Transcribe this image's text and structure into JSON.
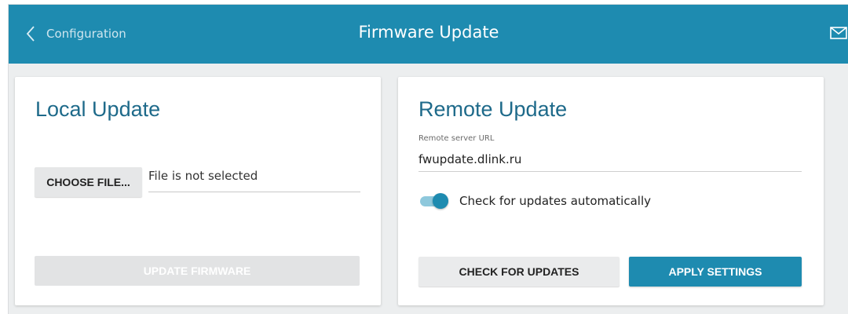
{
  "header": {
    "back_label": "Configuration",
    "title": "Firmware Update",
    "icons": {
      "back": "chevron-left-icon",
      "mail": "mail-icon"
    },
    "background_color": "#1e8bb0"
  },
  "local_update": {
    "title": "Local Update",
    "choose_file_label": "CHOOSE FILE...",
    "file_status": "File is not selected",
    "update_firmware_label": "UPDATE FIRMWARE",
    "update_firmware_disabled": true
  },
  "remote_update": {
    "title": "Remote Update",
    "url_label": "Remote server URL",
    "url_value": "fwupdate.dlink.ru",
    "auto_check_label": "Check for updates automatically",
    "auto_check_enabled": true,
    "check_button_label": "CHECK FOR UPDATES",
    "apply_button_label": "APPLY SETTINGS"
  },
  "colors": {
    "accent": "#1e8bb0",
    "title_text": "#1e6a8a",
    "background": "#eceeef"
  }
}
